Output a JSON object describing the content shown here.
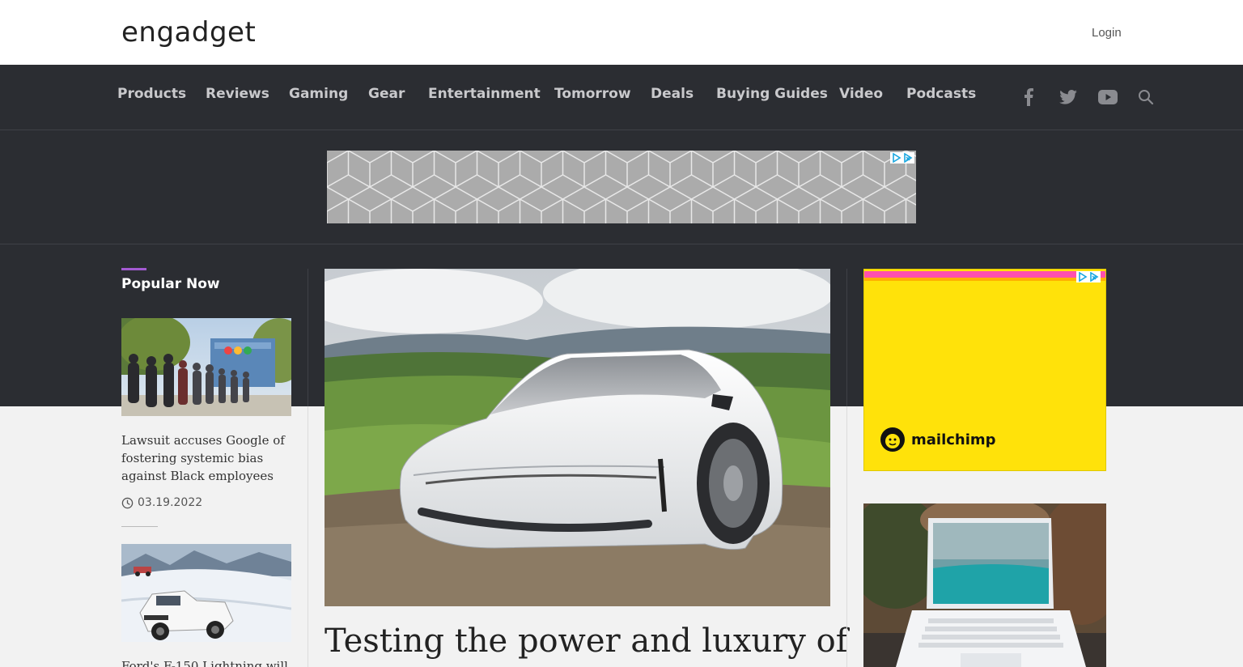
{
  "header": {
    "logo_text": "engadget",
    "login_label": "Login"
  },
  "nav": {
    "items": [
      {
        "label": "Products"
      },
      {
        "label": "Reviews"
      },
      {
        "label": "Gaming"
      },
      {
        "label": "Gear"
      },
      {
        "label": "Entertainment"
      },
      {
        "label": "Tomorrow"
      },
      {
        "label": "Deals"
      },
      {
        "label": "Buying Guides"
      },
      {
        "label": "Video"
      },
      {
        "label": "Podcasts"
      }
    ],
    "social_icons": [
      "facebook-icon",
      "twitter-icon",
      "youtube-icon",
      "search-icon"
    ]
  },
  "popular": {
    "heading": "Popular Now",
    "stories": [
      {
        "title": "Lawsuit accuses Google of fostering systemic bias against Black employees",
        "date": "03.19.2022"
      },
      {
        "title": "Ford's F-150 Lightning will",
        "date": ""
      }
    ]
  },
  "hero": {
    "title": "Testing the power and luxury of"
  },
  "side_ad": {
    "brand": "mailchimp"
  },
  "colors": {
    "dark_band": "#2b2d32",
    "accent": "#a35ad2",
    "ad_yellow": "#ffe20a"
  }
}
